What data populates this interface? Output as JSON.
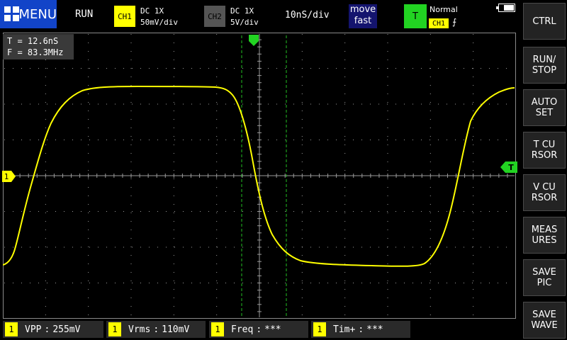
{
  "header": {
    "menu_label": "MENU",
    "run_state": "RUN",
    "ch1": {
      "tag": "CH1",
      "coupling": "DC  1X",
      "scale": "50mV/div"
    },
    "ch2": {
      "tag": "CH2",
      "coupling": "DC  1X",
      "scale": "5V/div"
    },
    "timebase": "10nS/div",
    "move_mode_line1": "move",
    "move_mode_line2": "fast",
    "trigger": {
      "icon_label": "T",
      "mode": "Normal",
      "source": "CH1",
      "edge_symbol": "⨍"
    },
    "battery_level": 0.7
  },
  "readout": {
    "period": "T = 12.6nS",
    "frequency": "F = 83.3MHz"
  },
  "markers": {
    "ch1": "1",
    "trigger": "T"
  },
  "side_buttons": [
    "CTRL",
    "RUN/\nSTOP",
    "AUTO\nSET",
    "T CU\nRSOR",
    "V CU\nRSOR",
    "MEAS\nURES",
    "SAVE\nPIC",
    "SAVE\nWAVE"
  ],
  "measurements": [
    {
      "num": "1",
      "label": "VPP",
      "value": "255mV"
    },
    {
      "num": "1",
      "label": "Vrms",
      "value": "110mV"
    },
    {
      "num": "1",
      "label": "Freq",
      "value": "***"
    },
    {
      "num": "1",
      "label": "Tim+",
      "value": "***"
    }
  ],
  "colors": {
    "ch1": "#ffff00",
    "trigger": "#22d322",
    "grid": "#9a9a9a",
    "menu": "#1244c8"
  }
}
